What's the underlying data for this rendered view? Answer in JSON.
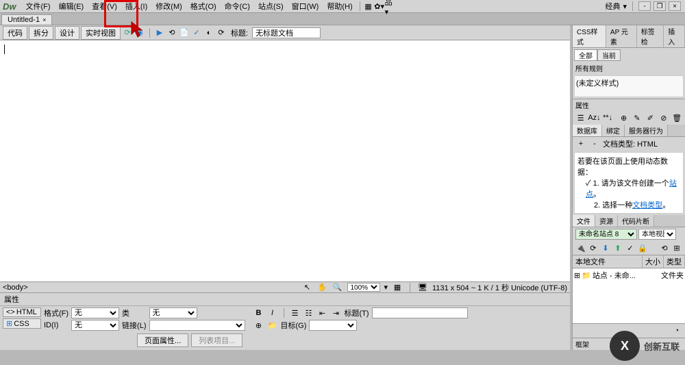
{
  "menubar": {
    "items": [
      "文件(F)",
      "编辑(E)",
      "查看(V)",
      "插入(I)",
      "修改(M)",
      "格式(O)",
      "命令(C)",
      "站点(S)",
      "窗口(W)",
      "帮助(H)"
    ],
    "layout_label": "经典"
  },
  "doc_tab": {
    "title": "Untitled-1"
  },
  "toolbar": {
    "code": "代码",
    "split": "拆分",
    "design": "设计",
    "live": "实时视图",
    "title_label": "标题:",
    "title_value": "无标题文档"
  },
  "status": {
    "path": "<body>",
    "zoom": "100%",
    "info": "1131 x 504 ~ 1 K / 1 秒 Unicode (UTF-8)"
  },
  "props": {
    "header": "属性",
    "html_tab": "HTML",
    "css_tab": "CSS",
    "format_label": "格式(F)",
    "format_val": "无",
    "id_label": "ID(I)",
    "id_val": "无",
    "class_label": "类",
    "class_val": "无",
    "link_label": "链接(L)",
    "title_label": "标题(T)",
    "target_label": "目标(G)",
    "page_props": "页面属性...",
    "list_item": "列表项目..."
  },
  "css_panel": {
    "tabs": [
      "CSS样式",
      "AP 元素",
      "标签检",
      "插入"
    ],
    "all": "全部",
    "current": "当前",
    "rules_title": "所有规则",
    "no_styles": "(未定义样式)",
    "props_title": "属性"
  },
  "db_panel": {
    "tabs": [
      "数据库",
      "绑定",
      "服务器行为"
    ],
    "doc_type": "文档类型: HTML",
    "hint": "若要在该页面上使用动态数据：",
    "step1_a": "1. 请为该文件创建一个",
    "step1_link": "站点",
    "step1_b": "。",
    "step2_a": "2. 选择一种",
    "step2_link": "文档类型",
    "step2_b": "。"
  },
  "files_panel": {
    "tabs": [
      "文件",
      "资源",
      "代码片断"
    ],
    "site": "未命名站点 8",
    "view": "本地视图",
    "col_file": "本地文件",
    "col_size": "大小",
    "col_type": "类型",
    "row1": "站点 - 未命...",
    "row1_type": "文件夹"
  },
  "frame_panel": {
    "title": "框架"
  }
}
